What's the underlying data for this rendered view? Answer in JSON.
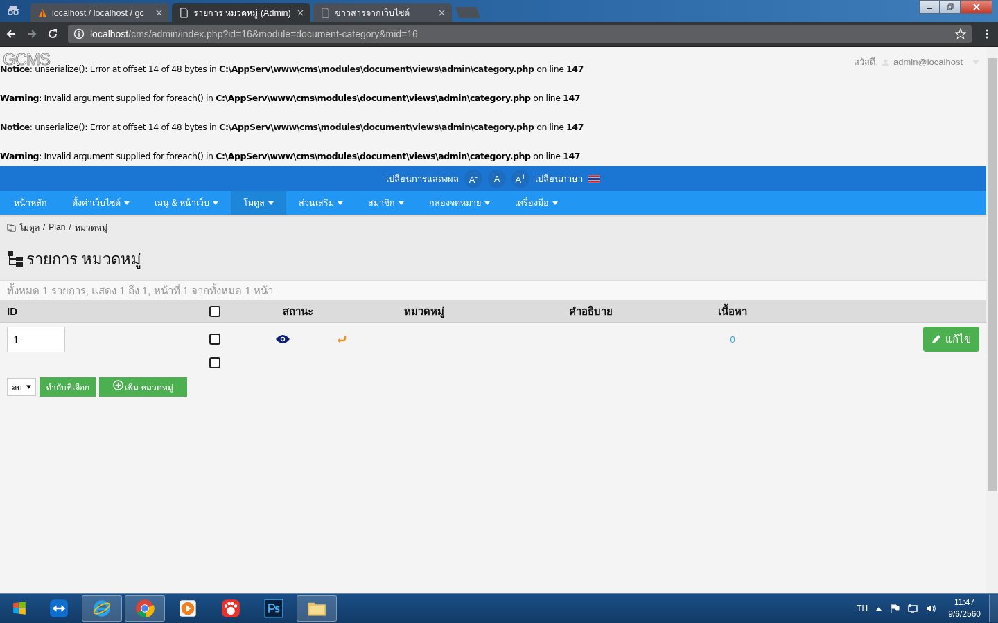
{
  "browser": {
    "tabs": [
      {
        "title": "localhost / localhost / gc",
        "kind": "sail",
        "selected": false
      },
      {
        "title": "รายการ หมวดหมู่ (Admin)",
        "kind": "page",
        "selected": true
      },
      {
        "title": "ข่าวสารจากเว็บไซต์",
        "kind": "page",
        "selected": false
      }
    ],
    "address": {
      "host": "localhost",
      "path": "/cms/admin/index.php?id=16&module=document-category&mid=16"
    }
  },
  "page": {
    "logo": "GCMS",
    "greeting": "สวัสดี,",
    "user": "admin@localhost",
    "messages": [
      {
        "kind": "notice",
        "text": "**Notice**: unserialize(): Error at offset 14 of 48 bytes in **C:\\AppServ\\www\\cms\\modules\\document\\views\\admin\\category.php** on line **147**"
      },
      {
        "kind": "warning",
        "text": "**Warning**: Invalid argument supplied for foreach() in **C:\\AppServ\\www\\cms\\modules\\document\\views\\admin\\category.php** on line **147**"
      },
      {
        "kind": "notice",
        "text": "**Notice**: unserialize(): Error at offset 14 of 48 bytes in **C:\\AppServ\\www\\cms\\modules\\document\\views\\admin\\category.php** on line **147**"
      },
      {
        "kind": "warning",
        "text": "**Warning**: Invalid argument supplied for foreach() in **C:\\AppServ\\www\\cms\\modules\\document\\views\\admin\\category.php** on line **147**"
      }
    ],
    "display_bar": {
      "label": "เปลี่ยนการแสดงผล",
      "font_buttons": [
        {
          "text": "A$^{-}$"
        },
        {
          "text": "A"
        },
        {
          "text": "A$^{+}$"
        }
      ],
      "language_label": "เปลี่ยนภาษา"
    },
    "menu": [
      {
        "label": "หน้าหลัก",
        "dropdown": false,
        "selected": false
      },
      {
        "label": "ตั้งค่าเว็บไซต์",
        "dropdown": true,
        "selected": false
      },
      {
        "label": "เมนู & หน้าเว็บ",
        "dropdown": true,
        "selected": false
      },
      {
        "label": "โมดูล",
        "dropdown": true,
        "selected": true
      },
      {
        "label": "ส่วนเสริม",
        "dropdown": true,
        "selected": false
      },
      {
        "label": "สมาชิก",
        "dropdown": true,
        "selected": false
      },
      {
        "label": "กล่องจดหมาย",
        "dropdown": true,
        "selected": false
      },
      {
        "label": "เครื่องมือ",
        "dropdown": true,
        "selected": false
      }
    ],
    "breadcrumb": {
      "separator": "/",
      "items": [
        "โมดูล",
        "Plan",
        "หมวดหมู่"
      ]
    },
    "title": "รายการ หมวดหมู่",
    "summary": "ทั้งหมด 1 รายการ, แสดง 1 ถึง 1, หน้าที่ 1 จากทั้งหมด 1 หน้า",
    "table": {
      "columns": [
        "ID",
        "สถานะ",
        "หมวดหมู่",
        "คำอธิบาย",
        "เนื้อหา"
      ],
      "select_all_checked": false,
      "rows": [
        {
          "id": "1",
          "checked": false,
          "published": true,
          "content": "0",
          "edit": "แก้ไข"
        }
      ],
      "footer_checked": false
    },
    "actions": {
      "select": "ลบ",
      "apply": "ทำกับที่เลือก",
      "add": "เพิ่ม หมวดหมู่"
    }
  },
  "taskbar": {
    "apps": [
      {
        "kind": "teamviewer",
        "selected": false
      },
      {
        "kind": "ie",
        "selected": true
      },
      {
        "kind": "chrome",
        "selected": true
      },
      {
        "kind": "media",
        "selected": false
      },
      {
        "kind": "paw",
        "selected": false
      },
      {
        "kind": "photoshop",
        "selected": false
      },
      {
        "kind": "folder",
        "selected": true
      }
    ],
    "language": "TH",
    "time": "11:47",
    "date": "9/6/2560"
  }
}
